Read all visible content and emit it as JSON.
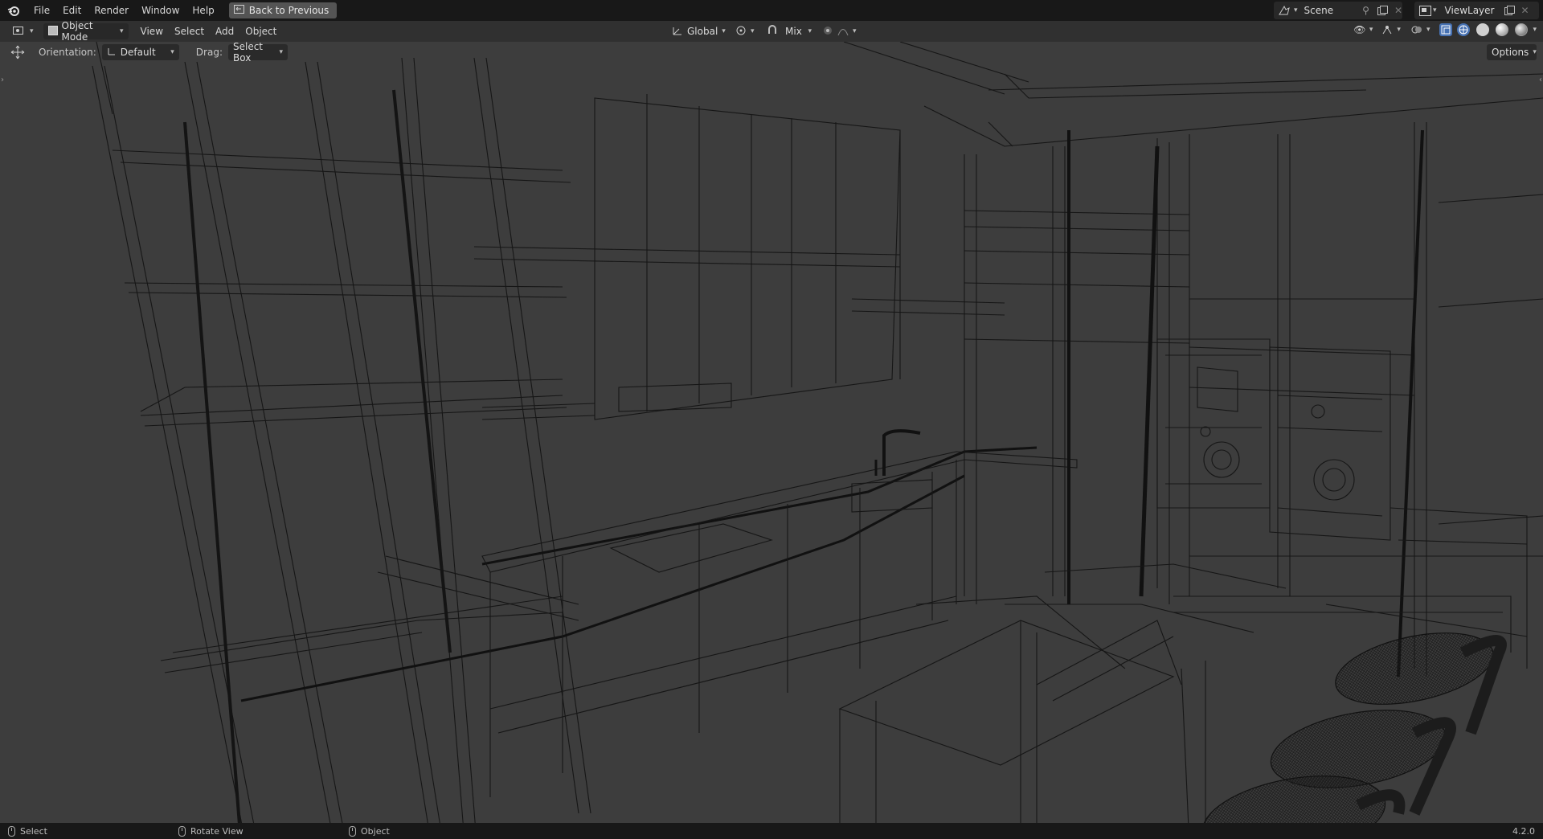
{
  "menubar": {
    "items": [
      "File",
      "Edit",
      "Render",
      "Window",
      "Help"
    ],
    "back_button": "Back to Previous",
    "scene": "Scene",
    "view_layer": "ViewLayer"
  },
  "header": {
    "mode": "Object Mode",
    "menus": [
      "View",
      "Select",
      "Add",
      "Object"
    ],
    "transform_orientation": "Global",
    "snap_mode": "Mix"
  },
  "tool_settings": {
    "orientation_label": "Orientation:",
    "orientation_value": "Default",
    "drag_label": "Drag:",
    "drag_value": "Select Box",
    "options": "Options"
  },
  "statusbar": {
    "left": "Select",
    "middle": "Rotate View",
    "right": "Object",
    "version": "4.2.0"
  },
  "colors": {
    "viewport_bg": "#3d3d3d",
    "wire": "#141414",
    "topbar_bg": "#181818",
    "accent_blue": "#4772b3"
  },
  "icons": [
    "blender-logo-icon",
    "back-icon",
    "scene-icon",
    "pin-icon",
    "duplicate-icon",
    "close-icon",
    "view-layer-icon",
    "editor-type-icon",
    "object-mode-icon",
    "orientation-icon",
    "pivot-icon",
    "snap-icon",
    "proportional-icon",
    "move-tool-icon",
    "visibility-icon",
    "gizmo-icon",
    "overlay-icon",
    "xray-icon",
    "wireframe-shading-icon",
    "solid-shading-icon",
    "material-shading-icon",
    "rendered-shading-icon"
  ]
}
